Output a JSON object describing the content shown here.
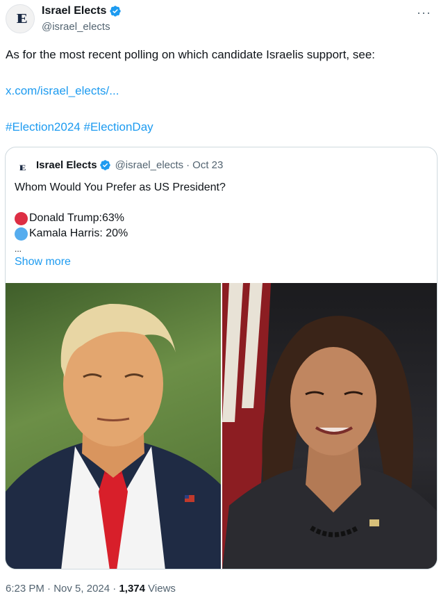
{
  "author": {
    "display_name": "Israel Elects",
    "handle": "@israel_elects",
    "avatar_text": "IE",
    "verified_icon": "verified-badge-icon"
  },
  "more_menu": "···",
  "tweet": {
    "text": "As for the  most recent polling on which candidate Israelis support, see:",
    "link": "x.com/israel_elects/...",
    "hashtags": [
      "#Election2024",
      "#ElectionDay"
    ]
  },
  "quote": {
    "display_name": "Israel Elects",
    "handle": "@israel_elects",
    "separator": "·",
    "date": "Oct 23",
    "question": "Whom Would You Prefer as US President?",
    "results": [
      {
        "label": "Donald Trump:63%",
        "color": "#dd2e44"
      },
      {
        "label": "Kamala Harris: 20%",
        "color": "#55acee"
      }
    ],
    "ellipsis": "...",
    "show_more": "Show more",
    "photos": [
      {
        "subject": "Donald Trump portrait"
      },
      {
        "subject": "Kamala Harris portrait"
      }
    ]
  },
  "footer": {
    "time": "6:23 PM",
    "date": "Nov 5, 2024",
    "views_count": "1,374",
    "views_label": "Views"
  },
  "colors": {
    "link": "#1d9bf0",
    "secondary_text": "#536471",
    "border": "#cfd9de"
  }
}
